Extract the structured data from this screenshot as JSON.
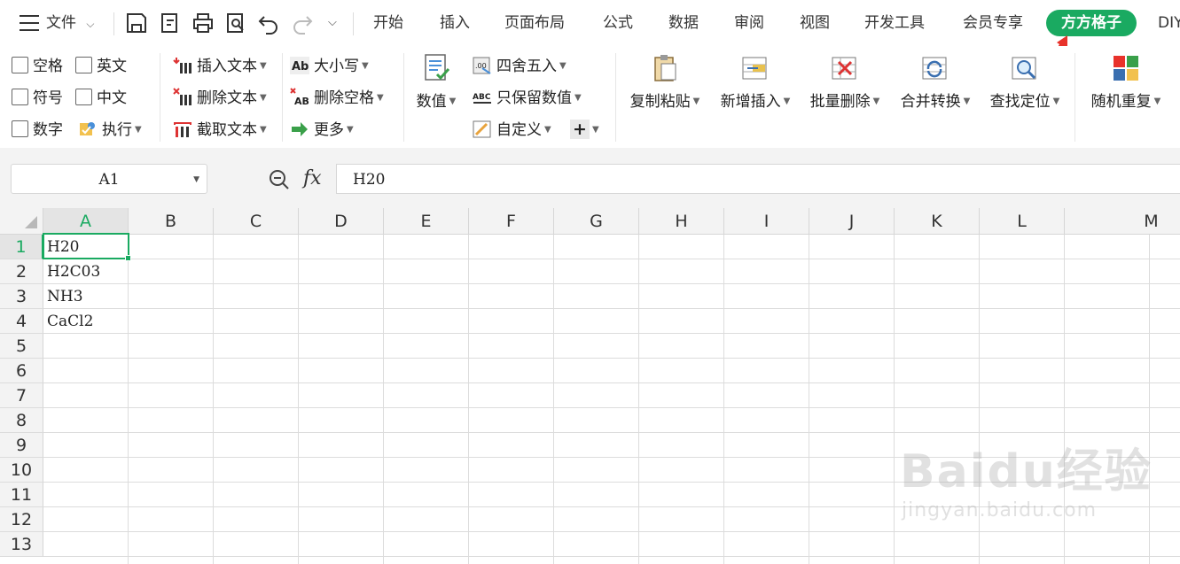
{
  "menubar": {
    "file_label": "文件",
    "tabs": [
      {
        "label": "开始"
      },
      {
        "label": "插入"
      },
      {
        "label": "页面布局"
      },
      {
        "label": "公式"
      },
      {
        "label": "数据"
      },
      {
        "label": "审阅"
      },
      {
        "label": "视图"
      },
      {
        "label": "开发工具"
      },
      {
        "label": "会员专享"
      },
      {
        "label": "方方格子"
      },
      {
        "label": "DIY"
      }
    ],
    "active_tab_color": "#1aaa61"
  },
  "ribbon": {
    "checkboxes": {
      "space": "空格",
      "english": "英文",
      "symbol": "符号",
      "chinese": "中文",
      "number": "数字"
    },
    "execute": "执行",
    "insert_text": "插入文本",
    "delete_text": "删除文本",
    "cut_text": "截取文本",
    "case": "大小写",
    "delete_space": "删除空格",
    "more": "更多",
    "numeric": "数值",
    "round": "四舍五入",
    "keep_numeric": "只保留数值",
    "custom": "自定义",
    "copy_paste": "复制粘贴",
    "add_insert": "新增插入",
    "batch_delete": "批量删除",
    "merge_convert": "合并转换",
    "find_locate": "查找定位",
    "random_repeat": "随机重复"
  },
  "formula_bar": {
    "name_box": "A1",
    "fx_label": "fx",
    "formula": "H20"
  },
  "sheet": {
    "columns": [
      "A",
      "B",
      "C",
      "D",
      "E",
      "F",
      "G",
      "H",
      "I",
      "J",
      "K",
      "L",
      "M"
    ],
    "rows": [
      "1",
      "2",
      "3",
      "4",
      "5",
      "6",
      "7",
      "8",
      "9",
      "10",
      "11",
      "12",
      "13"
    ],
    "cells": {
      "A1": "H20",
      "A2": "H2C03",
      "A3": "NH3",
      "A4": "CaCl2"
    },
    "selected_cell": "A1",
    "accent_color": "#1aaa61"
  },
  "watermark": {
    "line1": "Baidu经验",
    "line2": "jingyan.baidu.com"
  }
}
